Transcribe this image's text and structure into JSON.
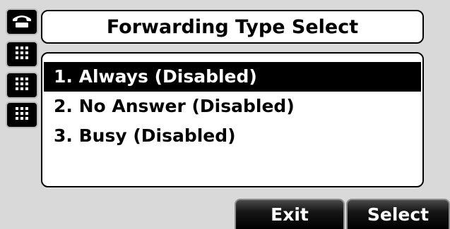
{
  "title": "Forwarding Type Select",
  "menu": {
    "items": [
      {
        "label": "1. Always (Disabled)",
        "selected": true
      },
      {
        "label": "2. No Answer (Disabled)",
        "selected": false
      },
      {
        "label": "3. Busy (Disabled)",
        "selected": false
      }
    ]
  },
  "softkeys": {
    "exit_label": "Exit",
    "select_label": "Select"
  },
  "line_keys": {
    "icons": [
      "handset-icon",
      "keypad-icon",
      "keypad-icon",
      "keypad-icon"
    ]
  },
  "colors": {
    "background": "#d9d9d9",
    "selected_row": "#000000",
    "softkey": "#000000"
  }
}
